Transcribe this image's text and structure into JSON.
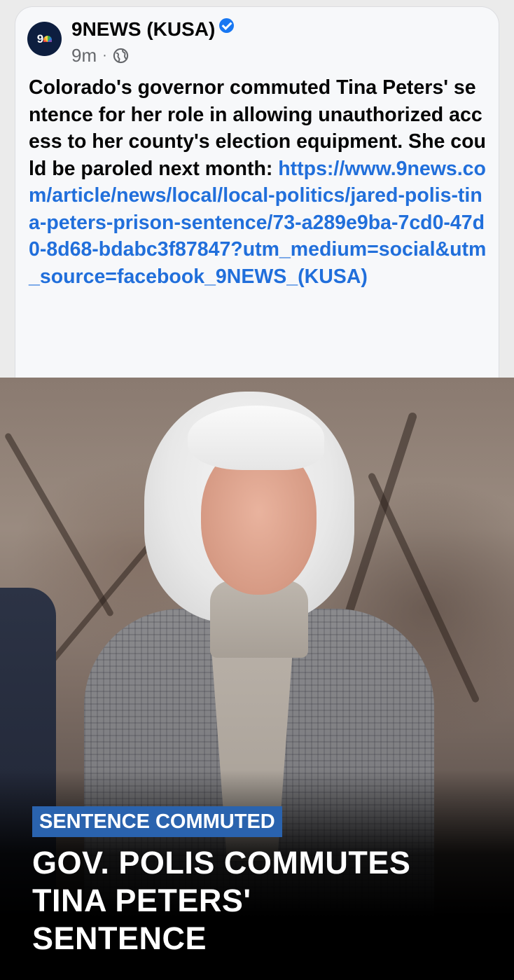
{
  "post": {
    "page_name": "9NEWS (KUSA)",
    "avatar_text": "9",
    "time": "9m",
    "separator": "·",
    "audience_icon": "globe-icon",
    "verified_icon": "verified-badge-icon",
    "text": "Colorado's governor commuted Tina Peters' sentence for her role in allowing unauthorized access to her county's election equipment. She could be paroled next month: ",
    "link": "https://www.9news.com/article/news/local/local-politics/jared-polis-tina-peters-prison-sentence/73-a289e9ba-7cd0-47d0-8d68-bdabc3f87847?utm_medium=social&utm_source=facebook_9NEWS_(KUSA)"
  },
  "image": {
    "tag": "SENTENCE COMMUTED",
    "headline_lines": [
      "GOV. POLIS COMMUTES",
      "TINA PETERS'",
      "SENTENCE"
    ]
  },
  "colors": {
    "link": "#216fdb",
    "verified": "#1877f2",
    "tag_bg": "#2a63ae",
    "avatar_bg": "#0d1e3f"
  }
}
